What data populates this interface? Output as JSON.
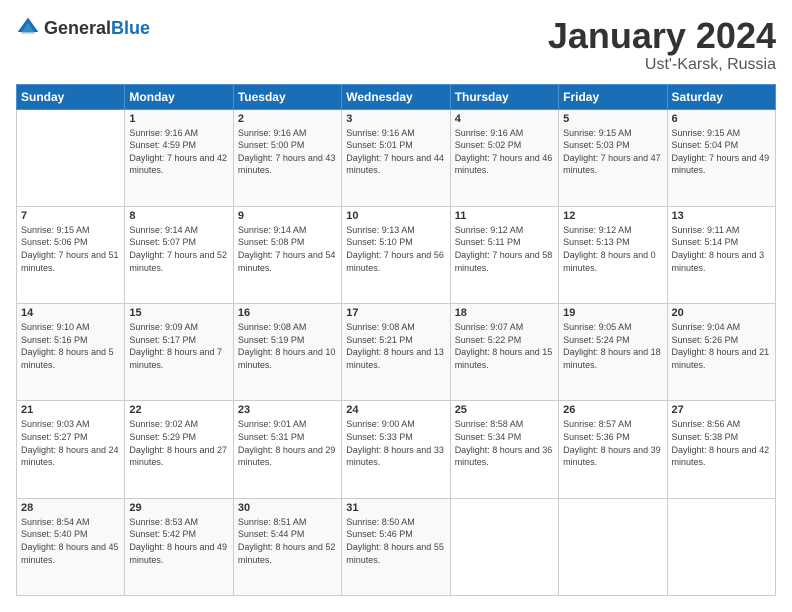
{
  "header": {
    "logo": {
      "general": "General",
      "blue": "Blue"
    },
    "title": "January 2024",
    "location": "Ust'-Karsk, Russia"
  },
  "weekdays": [
    "Sunday",
    "Monday",
    "Tuesday",
    "Wednesday",
    "Thursday",
    "Friday",
    "Saturday"
  ],
  "weeks": [
    [
      {
        "day": "",
        "sunrise": "",
        "sunset": "",
        "daylight": ""
      },
      {
        "day": "1",
        "sunrise": "Sunrise: 9:16 AM",
        "sunset": "Sunset: 4:59 PM",
        "daylight": "Daylight: 7 hours and 42 minutes."
      },
      {
        "day": "2",
        "sunrise": "Sunrise: 9:16 AM",
        "sunset": "Sunset: 5:00 PM",
        "daylight": "Daylight: 7 hours and 43 minutes."
      },
      {
        "day": "3",
        "sunrise": "Sunrise: 9:16 AM",
        "sunset": "Sunset: 5:01 PM",
        "daylight": "Daylight: 7 hours and 44 minutes."
      },
      {
        "day": "4",
        "sunrise": "Sunrise: 9:16 AM",
        "sunset": "Sunset: 5:02 PM",
        "daylight": "Daylight: 7 hours and 46 minutes."
      },
      {
        "day": "5",
        "sunrise": "Sunrise: 9:15 AM",
        "sunset": "Sunset: 5:03 PM",
        "daylight": "Daylight: 7 hours and 47 minutes."
      },
      {
        "day": "6",
        "sunrise": "Sunrise: 9:15 AM",
        "sunset": "Sunset: 5:04 PM",
        "daylight": "Daylight: 7 hours and 49 minutes."
      }
    ],
    [
      {
        "day": "7",
        "sunrise": "Sunrise: 9:15 AM",
        "sunset": "Sunset: 5:06 PM",
        "daylight": "Daylight: 7 hours and 51 minutes."
      },
      {
        "day": "8",
        "sunrise": "Sunrise: 9:14 AM",
        "sunset": "Sunset: 5:07 PM",
        "daylight": "Daylight: 7 hours and 52 minutes."
      },
      {
        "day": "9",
        "sunrise": "Sunrise: 9:14 AM",
        "sunset": "Sunset: 5:08 PM",
        "daylight": "Daylight: 7 hours and 54 minutes."
      },
      {
        "day": "10",
        "sunrise": "Sunrise: 9:13 AM",
        "sunset": "Sunset: 5:10 PM",
        "daylight": "Daylight: 7 hours and 56 minutes."
      },
      {
        "day": "11",
        "sunrise": "Sunrise: 9:12 AM",
        "sunset": "Sunset: 5:11 PM",
        "daylight": "Daylight: 7 hours and 58 minutes."
      },
      {
        "day": "12",
        "sunrise": "Sunrise: 9:12 AM",
        "sunset": "Sunset: 5:13 PM",
        "daylight": "Daylight: 8 hours and 0 minutes."
      },
      {
        "day": "13",
        "sunrise": "Sunrise: 9:11 AM",
        "sunset": "Sunset: 5:14 PM",
        "daylight": "Daylight: 8 hours and 3 minutes."
      }
    ],
    [
      {
        "day": "14",
        "sunrise": "Sunrise: 9:10 AM",
        "sunset": "Sunset: 5:16 PM",
        "daylight": "Daylight: 8 hours and 5 minutes."
      },
      {
        "day": "15",
        "sunrise": "Sunrise: 9:09 AM",
        "sunset": "Sunset: 5:17 PM",
        "daylight": "Daylight: 8 hours and 7 minutes."
      },
      {
        "day": "16",
        "sunrise": "Sunrise: 9:08 AM",
        "sunset": "Sunset: 5:19 PM",
        "daylight": "Daylight: 8 hours and 10 minutes."
      },
      {
        "day": "17",
        "sunrise": "Sunrise: 9:08 AM",
        "sunset": "Sunset: 5:21 PM",
        "daylight": "Daylight: 8 hours and 13 minutes."
      },
      {
        "day": "18",
        "sunrise": "Sunrise: 9:07 AM",
        "sunset": "Sunset: 5:22 PM",
        "daylight": "Daylight: 8 hours and 15 minutes."
      },
      {
        "day": "19",
        "sunrise": "Sunrise: 9:05 AM",
        "sunset": "Sunset: 5:24 PM",
        "daylight": "Daylight: 8 hours and 18 minutes."
      },
      {
        "day": "20",
        "sunrise": "Sunrise: 9:04 AM",
        "sunset": "Sunset: 5:26 PM",
        "daylight": "Daylight: 8 hours and 21 minutes."
      }
    ],
    [
      {
        "day": "21",
        "sunrise": "Sunrise: 9:03 AM",
        "sunset": "Sunset: 5:27 PM",
        "daylight": "Daylight: 8 hours and 24 minutes."
      },
      {
        "day": "22",
        "sunrise": "Sunrise: 9:02 AM",
        "sunset": "Sunset: 5:29 PM",
        "daylight": "Daylight: 8 hours and 27 minutes."
      },
      {
        "day": "23",
        "sunrise": "Sunrise: 9:01 AM",
        "sunset": "Sunset: 5:31 PM",
        "daylight": "Daylight: 8 hours and 29 minutes."
      },
      {
        "day": "24",
        "sunrise": "Sunrise: 9:00 AM",
        "sunset": "Sunset: 5:33 PM",
        "daylight": "Daylight: 8 hours and 33 minutes."
      },
      {
        "day": "25",
        "sunrise": "Sunrise: 8:58 AM",
        "sunset": "Sunset: 5:34 PM",
        "daylight": "Daylight: 8 hours and 36 minutes."
      },
      {
        "day": "26",
        "sunrise": "Sunrise: 8:57 AM",
        "sunset": "Sunset: 5:36 PM",
        "daylight": "Daylight: 8 hours and 39 minutes."
      },
      {
        "day": "27",
        "sunrise": "Sunrise: 8:56 AM",
        "sunset": "Sunset: 5:38 PM",
        "daylight": "Daylight: 8 hours and 42 minutes."
      }
    ],
    [
      {
        "day": "28",
        "sunrise": "Sunrise: 8:54 AM",
        "sunset": "Sunset: 5:40 PM",
        "daylight": "Daylight: 8 hours and 45 minutes."
      },
      {
        "day": "29",
        "sunrise": "Sunrise: 8:53 AM",
        "sunset": "Sunset: 5:42 PM",
        "daylight": "Daylight: 8 hours and 49 minutes."
      },
      {
        "day": "30",
        "sunrise": "Sunrise: 8:51 AM",
        "sunset": "Sunset: 5:44 PM",
        "daylight": "Daylight: 8 hours and 52 minutes."
      },
      {
        "day": "31",
        "sunrise": "Sunrise: 8:50 AM",
        "sunset": "Sunset: 5:46 PM",
        "daylight": "Daylight: 8 hours and 55 minutes."
      },
      {
        "day": "",
        "sunrise": "",
        "sunset": "",
        "daylight": ""
      },
      {
        "day": "",
        "sunrise": "",
        "sunset": "",
        "daylight": ""
      },
      {
        "day": "",
        "sunrise": "",
        "sunset": "",
        "daylight": ""
      }
    ]
  ]
}
